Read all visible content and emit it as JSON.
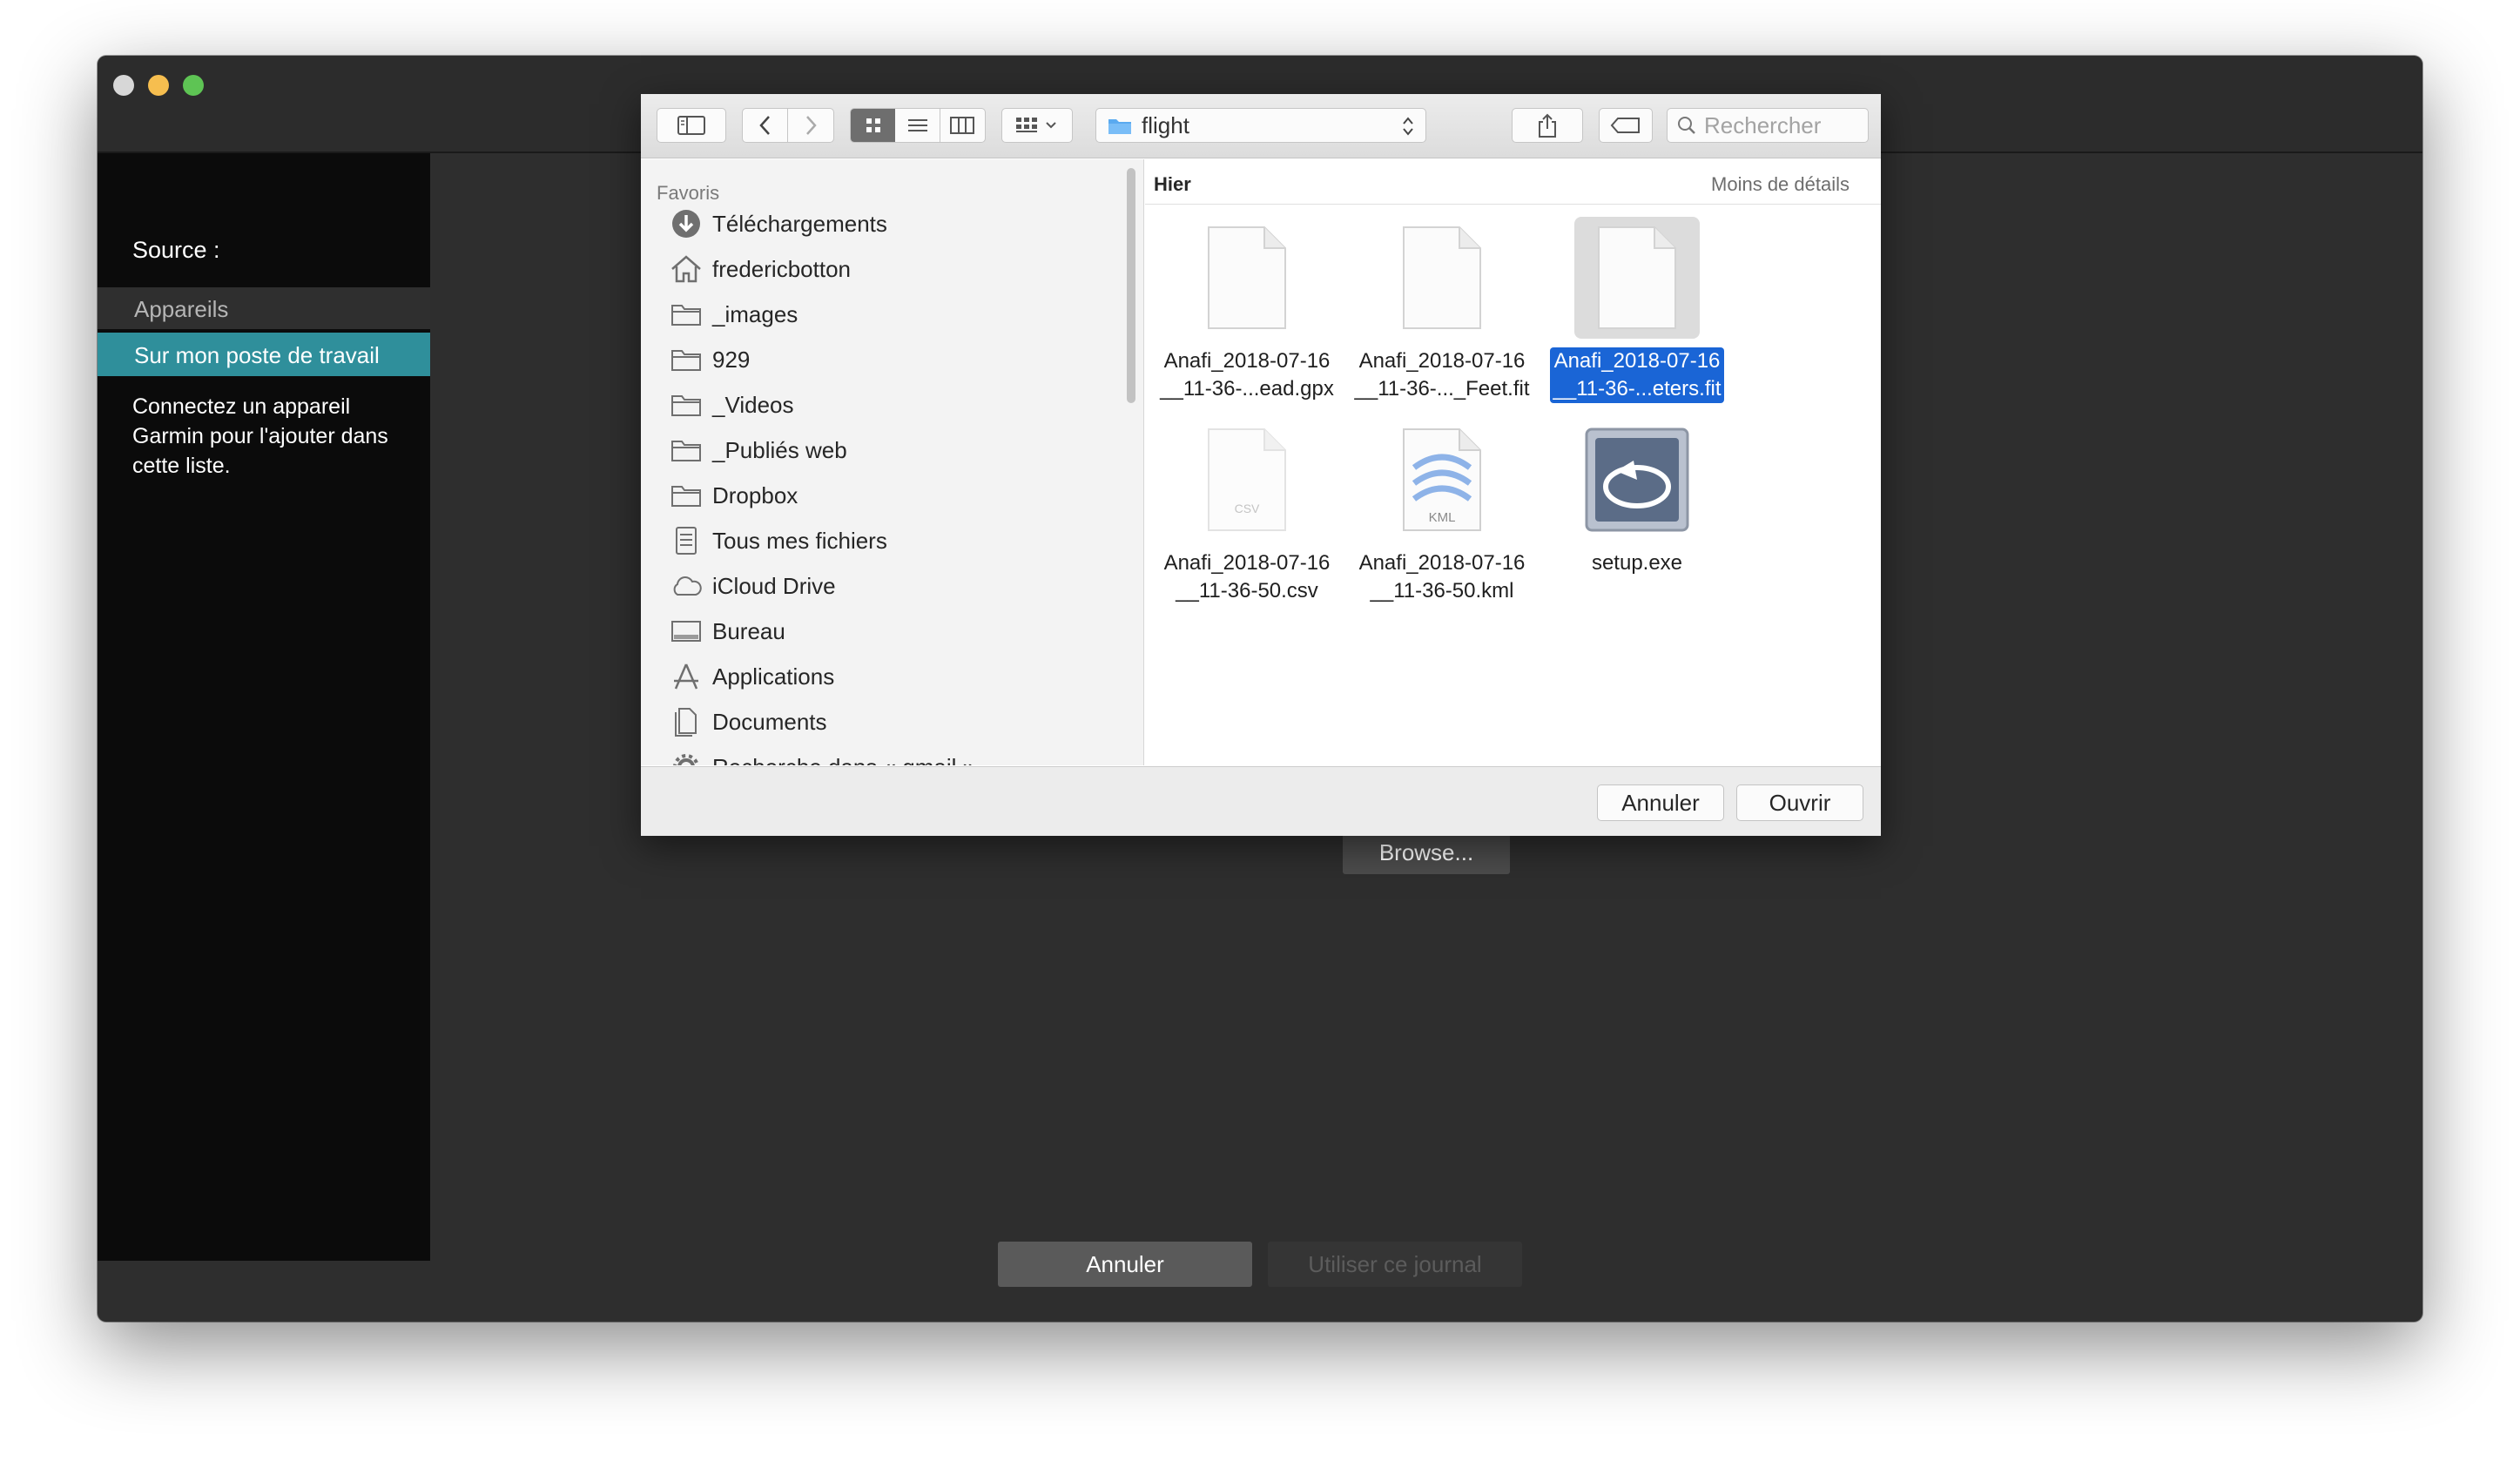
{
  "app": {
    "source_label": "Source :",
    "sidebar_section": "Appareils",
    "sidebar_active_item": "Sur mon poste de travail",
    "sidebar_hint": "Connectez un appareil Garmin pour l'ajouter dans cette liste.",
    "browse_label": "Browse...",
    "cancel_label": "Annuler",
    "use_log_label": "Utiliser ce journal"
  },
  "dialog": {
    "toolbar": {
      "current_folder": "flight",
      "search_placeholder": "Rechercher"
    },
    "favorites": {
      "header": "Favoris",
      "items": [
        {
          "label": "Téléchargements",
          "icon": "download-icon"
        },
        {
          "label": "fredericbotton",
          "icon": "home-icon"
        },
        {
          "label": "_images",
          "icon": "folder-icon"
        },
        {
          "label": "929",
          "icon": "folder-icon"
        },
        {
          "label": "_Videos",
          "icon": "folder-icon"
        },
        {
          "label": "_Publiés web",
          "icon": "folder-icon"
        },
        {
          "label": "Dropbox",
          "icon": "folder-icon"
        },
        {
          "label": "Tous mes fichiers",
          "icon": "all-files-icon"
        },
        {
          "label": "iCloud Drive",
          "icon": "cloud-icon"
        },
        {
          "label": "Bureau",
          "icon": "desktop-icon"
        },
        {
          "label": "Applications",
          "icon": "applications-icon"
        },
        {
          "label": "Documents",
          "icon": "documents-icon"
        },
        {
          "label": "Recherche dans « gmail »",
          "icon": "smart-folder-icon"
        }
      ]
    },
    "files": {
      "group_label": "Hier",
      "toggle_details": "Moins de détails",
      "items": [
        {
          "name": "Anafi_2018-07-16\n__11-36-...ead.gpx",
          "kind": "blank"
        },
        {
          "name": "Anafi_2018-07-16\n__11-36-..._Feet.fit",
          "kind": "blank"
        },
        {
          "name": "Anafi_2018-07-16\n__11-36-...eters.fit",
          "kind": "blank",
          "selected": true
        },
        {
          "name": "Anafi_2018-07-16\n__11-36-50.csv",
          "kind": "csv",
          "badge": "CSV"
        },
        {
          "name": "Anafi_2018-07-16\n__11-36-50.kml",
          "kind": "kml",
          "badge": "KML"
        },
        {
          "name": "setup.exe",
          "kind": "exe"
        }
      ]
    },
    "footer": {
      "cancel_label": "Annuler",
      "open_label": "Ouvrir"
    }
  },
  "colors": {
    "accent_teal": "#2f8f9b",
    "selection_blue": "#1a65d6"
  }
}
